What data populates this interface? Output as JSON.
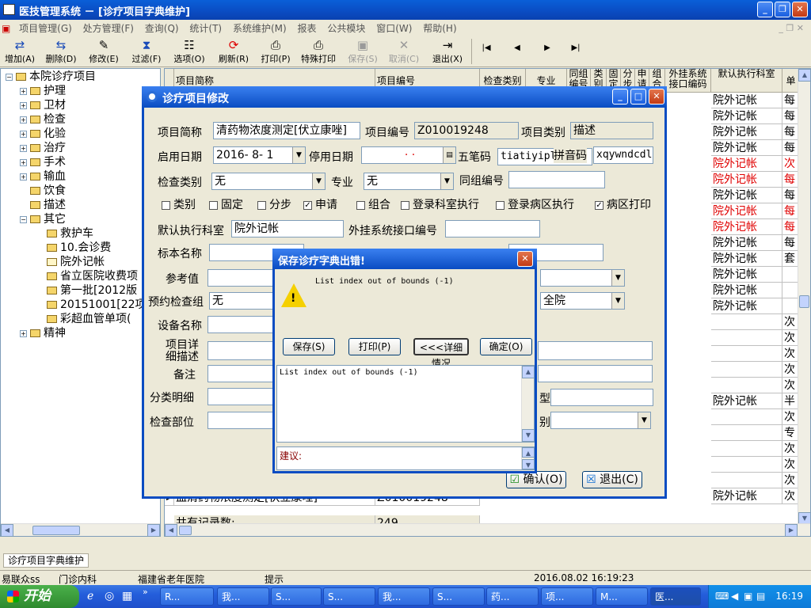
{
  "app": {
    "title": "医技管理系统 － [诊疗项目字典维护]"
  },
  "menu": [
    "项目管理(G)",
    "处方管理(F)",
    "查询(Q)",
    "统计(T)",
    "系统维护(M)",
    "报表",
    "公共模块",
    "窗口(W)",
    "帮助(H)"
  ],
  "toolbar": {
    "buttons": [
      {
        "label": "增加(A)",
        "icon": "add-icon"
      },
      {
        "label": "删除(D)",
        "icon": "delete-icon"
      },
      {
        "label": "修改(E)",
        "icon": "edit-icon"
      },
      {
        "label": "过滤(F)",
        "icon": "filter-icon"
      },
      {
        "label": "选项(O)",
        "icon": "options-icon"
      },
      {
        "label": "刷新(R)",
        "icon": "refresh-icon"
      },
      {
        "label": "打印(P)",
        "icon": "print-icon"
      },
      {
        "label": "特殊打印",
        "icon": "special-print-icon"
      },
      {
        "label": "保存(S)",
        "icon": "save-icon"
      },
      {
        "label": "取消(C)",
        "icon": "cancel-icon"
      },
      {
        "label": "退出(X)",
        "icon": "exit-icon"
      }
    ],
    "nav": [
      "|◀",
      "◀",
      "▶",
      "▶|"
    ]
  },
  "tree": {
    "root": "本院诊疗项目",
    "items": [
      "护理",
      "卫材",
      "检查",
      "化验",
      "治疗",
      "手术",
      "输血",
      "饮食",
      "描述",
      "其它"
    ],
    "children": [
      "救护车",
      "10.会诊费",
      "院外记帐",
      "省立医院收费项",
      "第一批[2012版",
      "20151001[22项",
      "彩超血管单项("
    ],
    "last": "精神"
  },
  "grid": {
    "headers": [
      "项目简称",
      "项目编号",
      "检查类别",
      "专业",
      "同组编号",
      "类别",
      "固定",
      "分步",
      "申请",
      "组合",
      "外挂系统接口编码",
      "默认执行科室",
      "单"
    ],
    "exec_dept": [
      "院外记帐",
      "院外记帐",
      "院外记帐",
      "院外记帐",
      "院外记帐",
      "院外记帐",
      "院外记帐",
      "院外记帐",
      "院外记帐",
      "院外记帐",
      "院外记帐",
      "院外记帐",
      "院外记帐",
      "院外记帐",
      "",
      "",
      "",
      "",
      "",
      "院外记帐",
      "",
      "",
      "",
      "",
      "",
      "院外记帐"
    ],
    "unit": [
      "每",
      "每",
      "每",
      "每",
      "次",
      "每",
      "每",
      "每",
      "每",
      "每",
      "套",
      "",
      "",
      "",
      "次",
      "次",
      "次",
      "次",
      "次",
      "半",
      "次",
      "专",
      "次",
      "次",
      "次",
      "次"
    ],
    "last_row_name": "血清药物浓度测定[伏立康唑]",
    "last_row_code": "Z010019248",
    "total_label": "共有记录数:",
    "total_count": "249"
  },
  "dialog": {
    "title": "诊疗项目修改",
    "short_name_label": "项目简称",
    "short_name": "清药物浓度测定[伏立康唑]",
    "code_label": "项目编号",
    "code": "Z010019248",
    "category_label": "项目类别",
    "category": "描述",
    "start_label": "启用日期",
    "start_date": "2016- 8- 1",
    "stop_label": "停用日期",
    "stop_date": "· ·",
    "wubi_label": "五笔码",
    "wubi": "tiatiyipl",
    "pinyin_label": "拼音码",
    "pinyin": "xqywndcdl",
    "exam_type_label": "检查类别",
    "exam_type": "无",
    "specialty_label": "专业",
    "specialty": "无",
    "group_label": "同组编号",
    "checks": [
      {
        "label": "类别",
        "checked": false
      },
      {
        "label": "固定",
        "checked": false
      },
      {
        "label": "分步",
        "checked": false
      },
      {
        "label": "申请",
        "checked": true
      },
      {
        "label": "组合",
        "checked": false
      },
      {
        "label": "登录科室执行",
        "checked": false
      },
      {
        "label": "登录病区执行",
        "checked": false
      },
      {
        "label": "病区打印",
        "checked": true
      }
    ],
    "exec_dept_label": "默认执行科室",
    "exec_dept": "院外记帐",
    "ext_code_label": "外挂系统接口编号",
    "sample_label": "标本名称",
    "ref_label": "参考值",
    "booking_label": "预约检查组",
    "booking": "无",
    "hospital_fragment": "全院",
    "device_label": "设备名称",
    "detail_label": "项目详细描述",
    "note_label": "备注",
    "class_detail_label": "分类明细",
    "type_fragment": "型",
    "part_label": "检查部位",
    "part_fragment": "别",
    "ok_label": "确认(O)",
    "exit_label": "退出(C)"
  },
  "error": {
    "title": "保存诊疗字典出错!",
    "message": "List index out of bounds (-1)",
    "buttons": [
      "保存(S)",
      "打印(P)",
      "<<<详细情况",
      "确定(O)"
    ],
    "detail": "List index out of bounds (-1)",
    "suggest_label": "建议:"
  },
  "status": {
    "tab": "诊疗项目字典维护",
    "user": "易联众ss",
    "dept": "门诊内科",
    "hospital": "福建省老年医院",
    "hint": "提示",
    "datetime": "2016.08.02 16:19:23"
  },
  "taskbar": {
    "start": "开始",
    "tasks": [
      "R...",
      "我...",
      "S...",
      "S...",
      "我...",
      "S...",
      "药...",
      "项...",
      "M...",
      "医..."
    ],
    "clock": "16:19"
  },
  "colors": {
    "accent": "#0a4cc2",
    "warn_red": "#e00000"
  }
}
